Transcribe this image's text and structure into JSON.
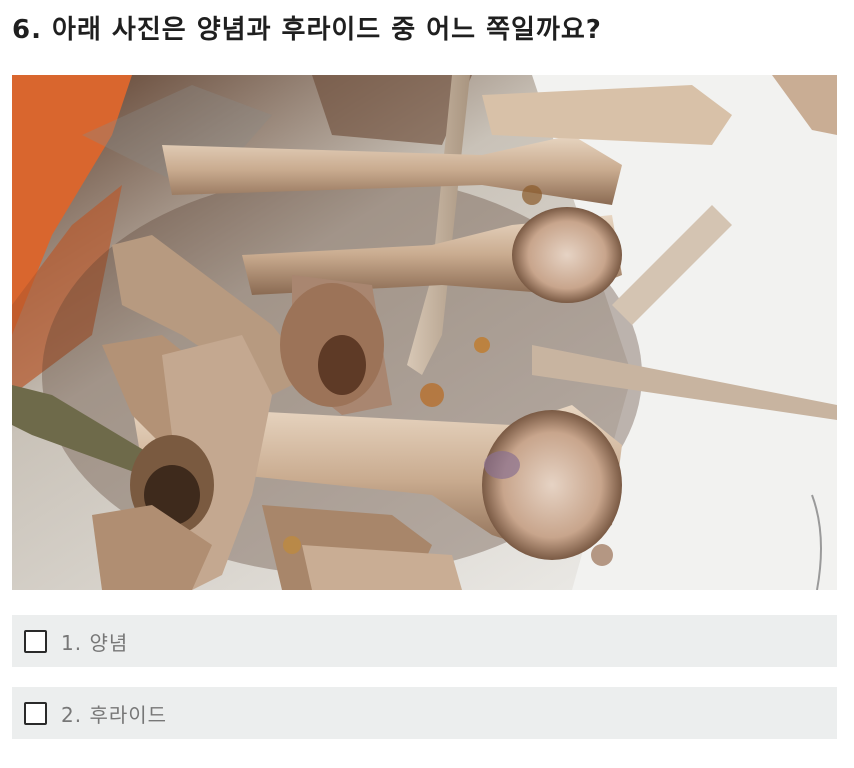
{
  "question": {
    "title": "6. 아래 사진은 양념과 후라이드 중 어느 쪽일까요?"
  },
  "photo": {
    "subject": "chicken-bones-photo"
  },
  "options": [
    {
      "label": "1. 양념",
      "checked": false
    },
    {
      "label": "2. 후라이드",
      "checked": false
    }
  ],
  "colors": {
    "option_background": "#eceeee",
    "option_text": "#777777",
    "title_text": "#1f1f1f"
  }
}
